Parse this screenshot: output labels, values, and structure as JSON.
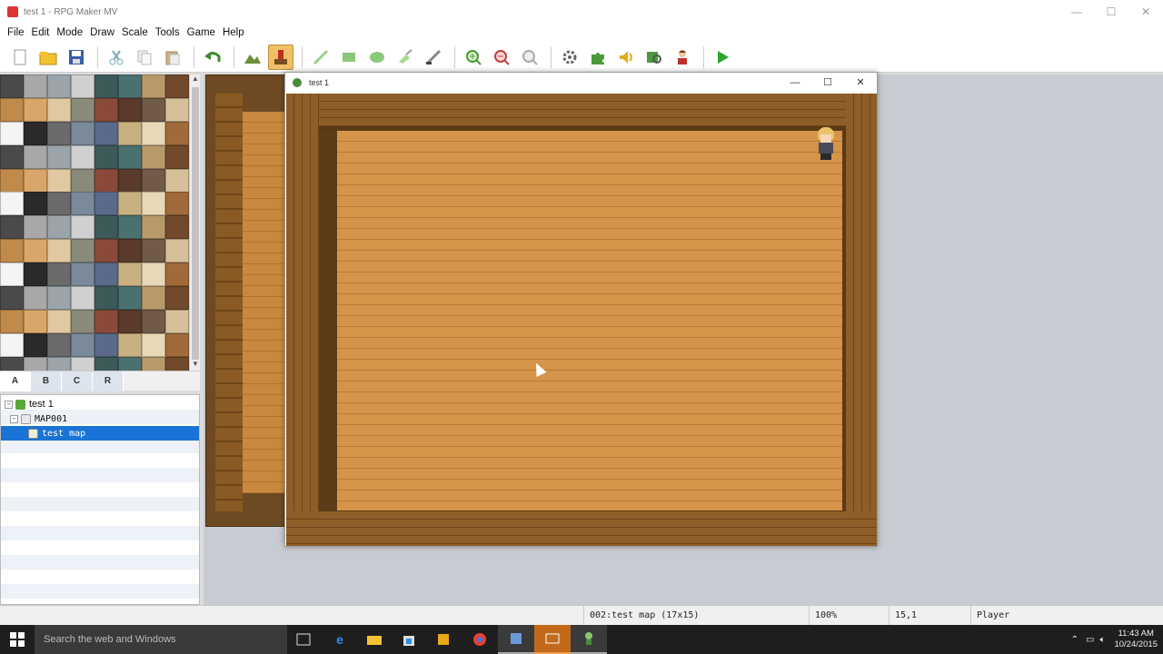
{
  "window": {
    "title": "test 1 - RPG Maker MV",
    "minimize": "—",
    "maximize": "☐",
    "close": "✕"
  },
  "menu": [
    "File",
    "Edit",
    "Mode",
    "Draw",
    "Scale",
    "Tools",
    "Game",
    "Help"
  ],
  "toolbar": {
    "new": "new-project",
    "open": "open-project",
    "save": "save-project",
    "cut": "cut",
    "copy": "copy",
    "paste": "paste",
    "undo": "undo",
    "map_mode": "map-mode",
    "event_mode": "event-mode",
    "pencil": "pencil",
    "rectangle": "rectangle",
    "ellipse": "ellipse",
    "fill": "fill",
    "shadow_pen": "shadow-pen",
    "zoom_in": "zoom-in",
    "zoom_out": "zoom-out",
    "actual_size": "actual-size",
    "database": "database",
    "plugin_manager": "plugin-manager",
    "sound_test": "sound-test",
    "event_searcher": "event-searcher",
    "character_generator": "character-generator",
    "playtest": "playtest"
  },
  "tileset_tabs": [
    "A",
    "B",
    "C",
    "R"
  ],
  "tileset_selected_tab": "A",
  "map_tree": {
    "root": "test 1",
    "items": [
      {
        "label": "MAP001",
        "depth": 1
      },
      {
        "label": "test map",
        "depth": 2,
        "selected": true
      }
    ]
  },
  "game_window": {
    "title": "test 1",
    "minimize": "—",
    "maximize": "☐",
    "close": "✕"
  },
  "status": {
    "map": "002:test map (17x15)",
    "zoom": "100%",
    "coords": "15,1",
    "selection": "Player"
  },
  "taskbar": {
    "search_placeholder": "Search the web and Windows",
    "time": "11:43 AM",
    "date": "10/24/2015"
  },
  "colors": {
    "accent_selected": "#1a73d6",
    "taskbar_active": "#c26a1a",
    "floor": "#d5944a"
  }
}
